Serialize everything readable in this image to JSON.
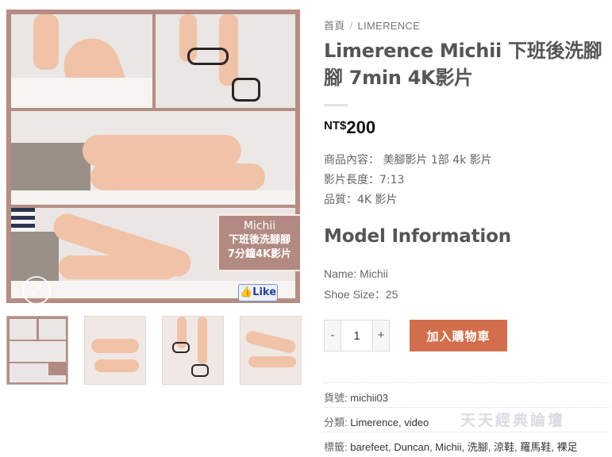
{
  "gallery": {
    "overlay_line1": "Michii",
    "overlay_line2": "下班後洗腳腳",
    "overlay_line3": "7分鐘4K影片",
    "like_badge": "Like",
    "zoom_icon": "expand-icon",
    "thumbnail_count": 4,
    "active_thumbnail": 1
  },
  "breadcrumb": {
    "home": "首頁",
    "separator": "/",
    "category": "LIMERENCE"
  },
  "product": {
    "title": "Limerence Michii 下班後洗腳腳 7min 4K影片",
    "price_currency": "NT$",
    "price_amount": "200",
    "details": [
      "商品內容：  美腳影片 1部 4k 影片",
      "影片長度：7:13",
      "品質：4K 影片"
    ]
  },
  "model_info": {
    "heading": "Model Information",
    "name": "Name: Michii",
    "shoe_size": "Shoe Size：25"
  },
  "cart": {
    "minus_label": "-",
    "plus_label": "+",
    "quantity": "1",
    "add_to_cart_label": "加入購物車",
    "button_color": "#d26e4b"
  },
  "meta": {
    "sku_label": "貨號:",
    "sku_value": "michii03",
    "category_label": "分類:",
    "categories": [
      "Limerence",
      "video"
    ],
    "tags_label": "標籤:",
    "tags": [
      "barefeet",
      "Duncan",
      "Michii",
      "洗腳",
      "涼鞋",
      "羅馬鞋",
      "裸足"
    ]
  },
  "watermark": "天天經典論壇"
}
